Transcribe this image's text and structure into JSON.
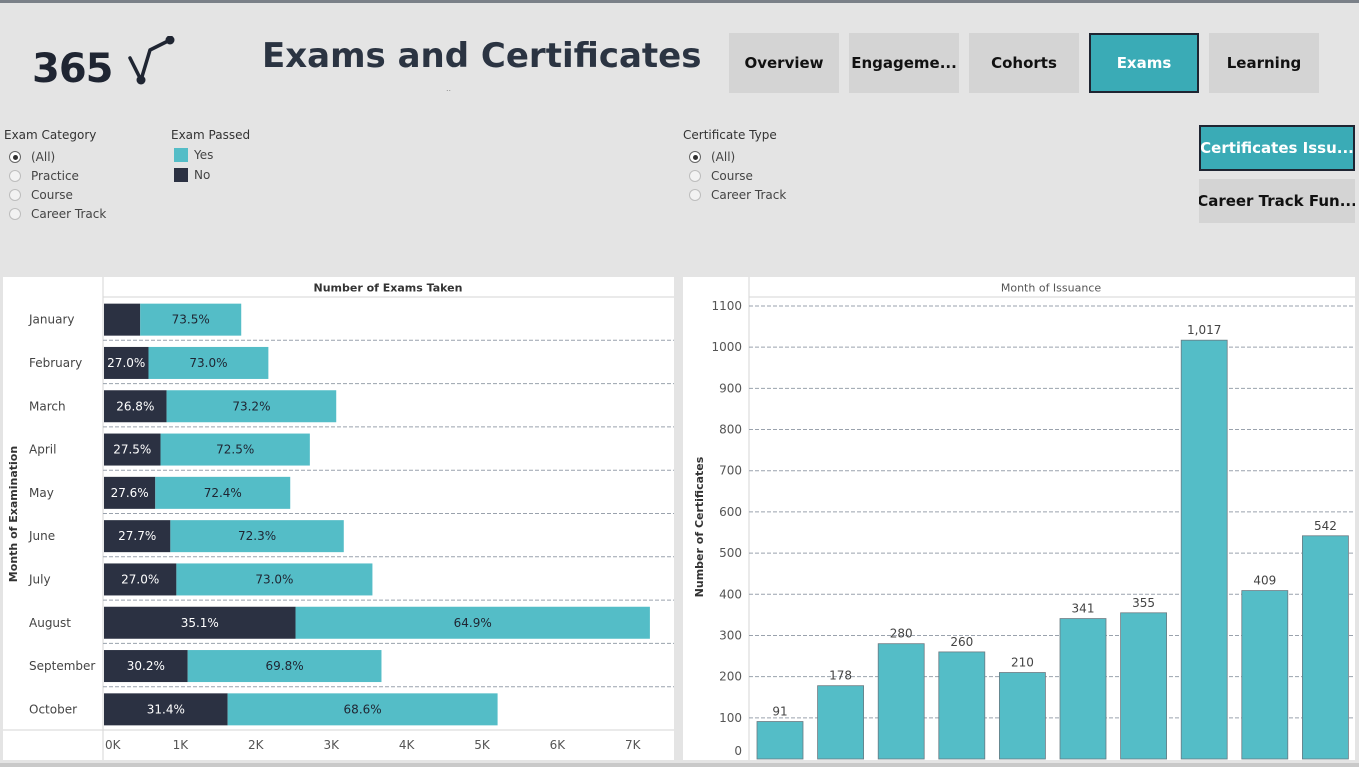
{
  "header": {
    "logo_text": "365",
    "title": "Exams and Certificates",
    "title_hint": "..",
    "nav": [
      {
        "label": "Overview",
        "active": false
      },
      {
        "label": "Engageme...",
        "active": false
      },
      {
        "label": "Cohorts",
        "active": false
      },
      {
        "label": "Exams",
        "active": true
      },
      {
        "label": "Learning",
        "active": false
      }
    ],
    "side_buttons": [
      {
        "label": "Certificates Issu...",
        "active": true
      },
      {
        "label": "Career Track Fun...",
        "active": false
      }
    ]
  },
  "filters": {
    "exam_category": {
      "title": "Exam Category",
      "options": [
        "(All)",
        "Practice",
        "Course",
        "Career Track"
      ],
      "selected": "(All)"
    },
    "exam_passed": {
      "title": "Exam Passed",
      "items": [
        {
          "label": "Yes",
          "color": "#54bdc7"
        },
        {
          "label": "No",
          "color": "#2b3142"
        }
      ]
    },
    "certificate_type": {
      "title": "Certificate Type",
      "options": [
        "(All)",
        "Course",
        "Career Track"
      ],
      "selected": "(All)"
    }
  },
  "colors": {
    "passed": "#54bdc7",
    "failed": "#2b3142",
    "accent": "#3aabb6"
  },
  "chart_data": [
    {
      "type": "bar",
      "orientation": "horizontal",
      "stacked": true,
      "title": "Number of Exams Taken",
      "ylabel": "Month of Examination",
      "categories": [
        "January",
        "February",
        "March",
        "April",
        "May",
        "June",
        "July",
        "August",
        "September",
        "October"
      ],
      "xlim": [
        0,
        7500
      ],
      "x_ticks": [
        "0K",
        "1K",
        "2K",
        "3K",
        "4K",
        "5K",
        "6K",
        "7K"
      ],
      "grid": true,
      "series": [
        {
          "name": "No",
          "values": [
            480,
            590,
            830,
            750,
            680,
            880,
            960,
            2540,
            1110,
            1640
          ],
          "labels": [
            "",
            "27.0%",
            "26.8%",
            "27.5%",
            "27.6%",
            "27.7%",
            "27.0%",
            "35.1%",
            "30.2%",
            "31.4%"
          ]
        },
        {
          "name": "Yes",
          "values": [
            1340,
            1590,
            2250,
            1980,
            1790,
            2300,
            2600,
            4700,
            2570,
            3580
          ],
          "labels": [
            "73.5%",
            "73.0%",
            "73.2%",
            "72.5%",
            "72.4%",
            "72.3%",
            "73.0%",
            "64.9%",
            "69.8%",
            "68.6%"
          ]
        }
      ]
    },
    {
      "type": "bar",
      "title": "Month of Issuance",
      "ylabel": "Number of Certificates",
      "categories": [
        "",
        "",
        "",
        "",
        "",
        "",
        "",
        "",
        "",
        ""
      ],
      "values": [
        91,
        178,
        280,
        260,
        210,
        341,
        355,
        1017,
        409,
        542
      ],
      "data_labels": [
        "91",
        "178",
        "280",
        "260",
        "210",
        "341",
        "355",
        "1,017",
        "409",
        "542"
      ],
      "ylim": [
        0,
        1100
      ],
      "y_ticks": [
        "0",
        "100",
        "200",
        "300",
        "400",
        "500",
        "600",
        "700",
        "800",
        "900",
        "1000",
        "1100"
      ],
      "grid": true
    }
  ]
}
